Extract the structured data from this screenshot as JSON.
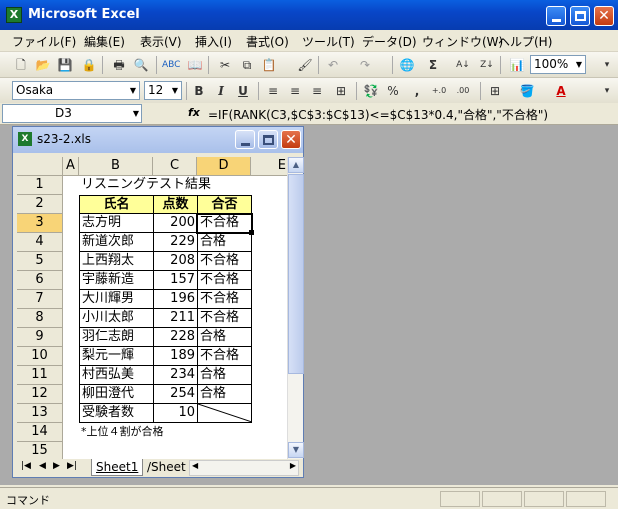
{
  "window": {
    "title": "Microsoft Excel"
  },
  "menu": [
    "ファイル(F)",
    "編集(E)",
    "表示(V)",
    "挿入(I)",
    "書式(O)",
    "ツール(T)",
    "データ(D)",
    "ウィンドウ(W)",
    "ヘルプ(H)"
  ],
  "toolbar": {
    "zoom": "100%"
  },
  "format": {
    "font": "Osaka",
    "size": "12",
    "bold": "B",
    "italic": "I",
    "underline": "U",
    "percent": "%",
    "comma": ","
  },
  "formula_bar": {
    "name_box": "D3",
    "fx": "fx",
    "formula": "=IF(RANK(C3,$C$3:$C$13)<=$C$13*0.4,\"合格\",\"不合格\")"
  },
  "workbook": {
    "title": "s23-2.xls"
  },
  "sheet": {
    "columns": [
      "A",
      "B",
      "C",
      "D",
      "E"
    ],
    "rows": [
      "1",
      "2",
      "3",
      "4",
      "5",
      "6",
      "7",
      "8",
      "9",
      "10",
      "11",
      "12",
      "13",
      "14",
      "15"
    ],
    "title": "リスニングテスト結果",
    "headers": {
      "name": "氏名",
      "score": "点数",
      "result": "合否"
    },
    "data": [
      {
        "name": "志方明",
        "score": "200",
        "result": "不合格"
      },
      {
        "name": "新道次郎",
        "score": "229",
        "result": "合格"
      },
      {
        "name": "上西翔太",
        "score": "208",
        "result": "不合格"
      },
      {
        "name": "宇藤新造",
        "score": "157",
        "result": "不合格"
      },
      {
        "name": "大川輝男",
        "score": "196",
        "result": "不合格"
      },
      {
        "name": "小川太郎",
        "score": "211",
        "result": "不合格"
      },
      {
        "name": "羽仁志朗",
        "score": "228",
        "result": "合格"
      },
      {
        "name": "梨元一輝",
        "score": "189",
        "result": "不合格"
      },
      {
        "name": "村西弘美",
        "score": "234",
        "result": "合格"
      },
      {
        "name": "柳田澄代",
        "score": "254",
        "result": "合格"
      }
    ],
    "count_label": "受験者数",
    "count_value": "10",
    "note": "*上位４割が合格"
  },
  "tabs": {
    "sheet1": "Sheet1",
    "sheet_next": "/Sheet"
  },
  "status": {
    "text": "コマンド"
  }
}
